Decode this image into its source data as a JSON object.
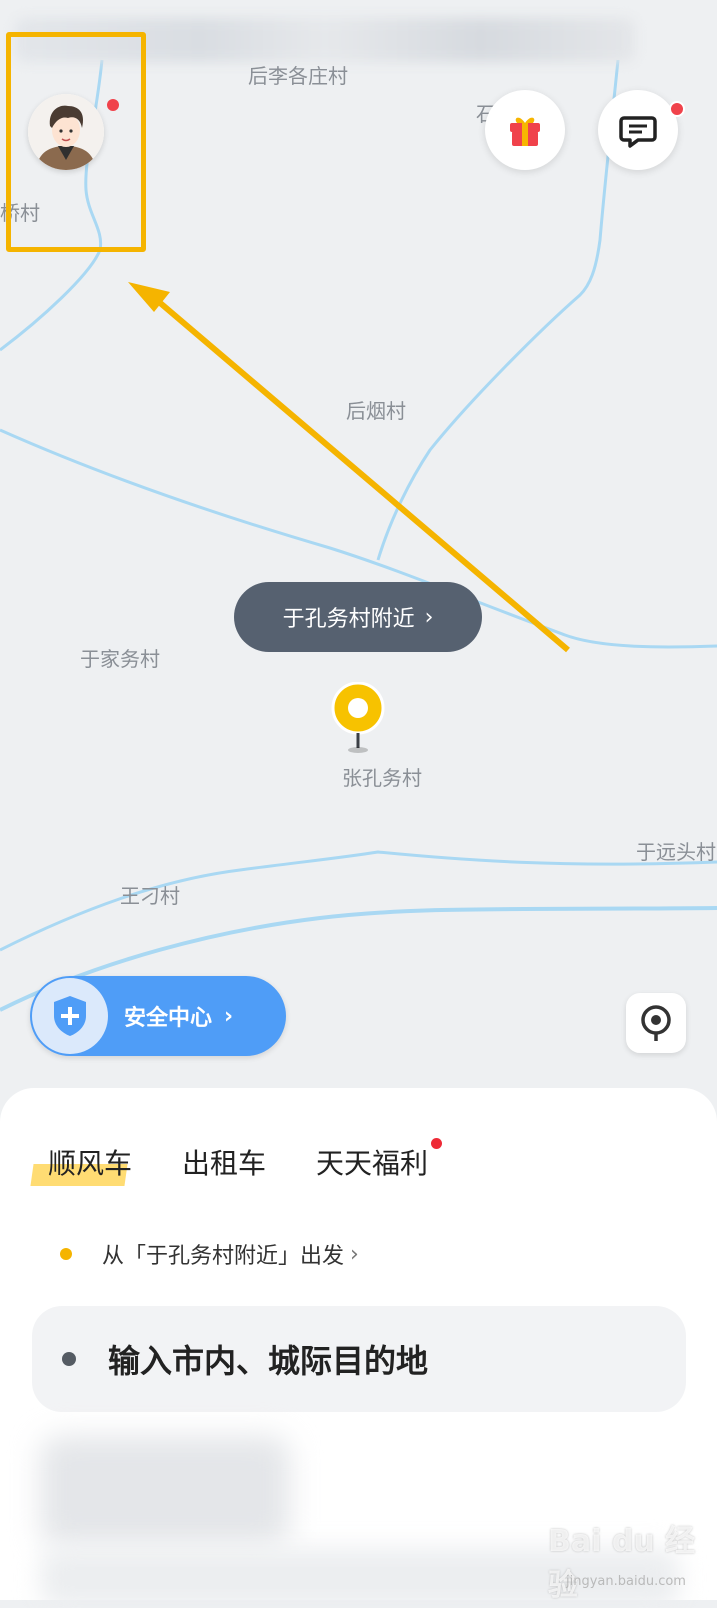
{
  "map": {
    "places": {
      "houli": "后李各庄村",
      "shi": "石",
      "qiaocun": "桥村",
      "houyan": "后烟村",
      "yujiawu": "于家务村",
      "zhangkongwu": "张孔务村",
      "yuyuantou": "于远头村",
      "wangdiao": "王刁村"
    },
    "location_pill": "于孔务村附近",
    "safety_center": "安全中心"
  },
  "panel": {
    "tabs": [
      {
        "label": "顺风车"
      },
      {
        "label": "出租车"
      },
      {
        "label": "天天福利"
      }
    ],
    "origin_text": "从「于孔务村附近」出发",
    "destination_placeholder": "输入市内、城际目的地"
  },
  "watermark": {
    "brand": "Bai du 经验",
    "url": "jingyan.baidu.com"
  },
  "colors": {
    "accent_yellow": "#f5b400",
    "safety_blue": "#4f9df7",
    "badge_red": "#f0424b",
    "road_blue": "#a6d6f2"
  }
}
